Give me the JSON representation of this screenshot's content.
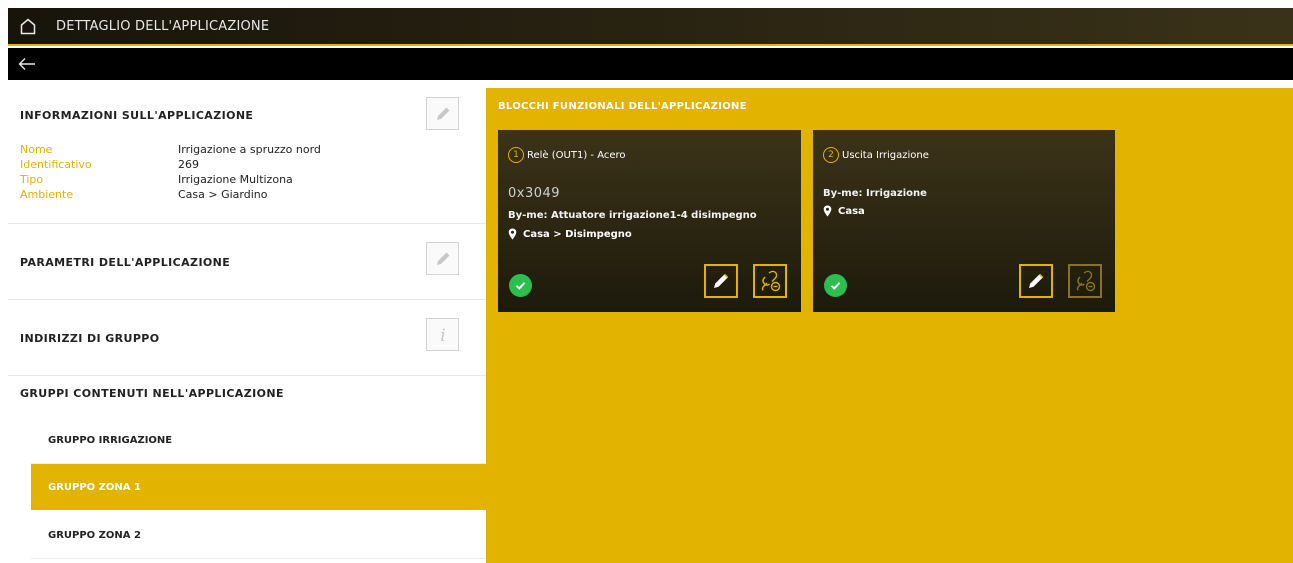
{
  "header": {
    "title": "DETTAGLIO DELL'APPLICAZIONE"
  },
  "colors": {
    "accent": "#e2b300",
    "ok": "#2dbf4d",
    "card_bg": "#2a2412"
  },
  "icons": {
    "home": "home-icon",
    "back": "arrow-left-icon",
    "edit": "pencil-icon",
    "info": "info-icon",
    "location": "map-pin-icon",
    "ok": "check-circle-icon",
    "unlink": "link-remove-icon"
  },
  "left": {
    "info_section": {
      "title": "INFORMAZIONI SULL'APPLICAZIONE",
      "rows": [
        {
          "key": "Nome",
          "value": "Irrigazione a spruzzo nord"
        },
        {
          "key": "Identificativo",
          "value": "269"
        },
        {
          "key": "Tipo",
          "value": "Irrigazione Multizona"
        },
        {
          "key": "Ambiente",
          "value": "Casa > Giardino"
        }
      ]
    },
    "params_section": {
      "title": "PARAMETRI DELL'APPLICAZIONE"
    },
    "group_addr_section": {
      "title": "INDIRIZZI DI GRUPPO"
    },
    "groups_section": {
      "title": "GRUPPI CONTENUTI NELL'APPLICAZIONE",
      "items": [
        {
          "label": "GRUPPO IRRIGAZIONE",
          "active": false
        },
        {
          "label": "GRUPPO ZONA 1",
          "active": true
        },
        {
          "label": "GRUPPO ZONA 2",
          "active": false
        }
      ]
    }
  },
  "right": {
    "title": "BLOCCHI FUNZIONALI DELL'APPLICAZIONE",
    "cards": [
      {
        "number": "1",
        "name": "Relè (OUT1) - Acero",
        "address": "0x3049",
        "byme": "By-me: Attuatore irrigazione1-4 disimpegno",
        "location": "Casa > Disimpegno",
        "status": "ok"
      },
      {
        "number": "2",
        "name": "Uscita Irrigazione",
        "address": "",
        "byme": "By-me: Irrigazione",
        "location": "Casa",
        "status": "ok"
      }
    ]
  }
}
